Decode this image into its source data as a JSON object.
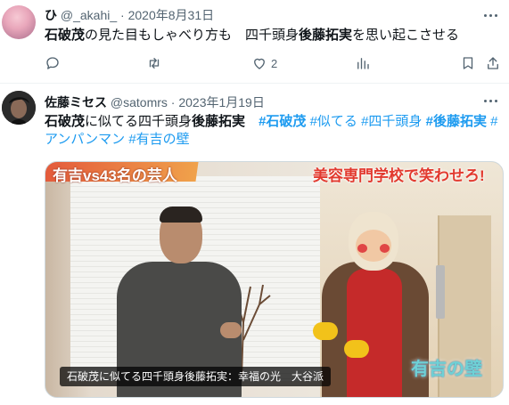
{
  "tweets": [
    {
      "display_name": "ひ",
      "handle": "@_akahi_",
      "separator": "·",
      "date": "2020年8月31日",
      "text_parts": [
        {
          "text": "石破茂",
          "style": "bold"
        },
        {
          "text": "の見た目もしゃべり方も　四千頭身",
          "style": "plain"
        },
        {
          "text": "後藤拓実",
          "style": "bold"
        },
        {
          "text": "を思い起こさせる",
          "style": "plain"
        }
      ],
      "actions": {
        "reply": {
          "icon": "reply-icon",
          "count": ""
        },
        "retweet": {
          "icon": "retweet-icon",
          "count": ""
        },
        "like": {
          "icon": "heart-icon",
          "count": "2"
        },
        "views": {
          "icon": "views-icon",
          "count": ""
        },
        "bookmark": {
          "icon": "bookmark-icon"
        },
        "share": {
          "icon": "share-icon"
        }
      }
    },
    {
      "display_name": "佐藤ミセス",
      "handle": "@satomrs",
      "separator": "·",
      "date": "2023年1月19日",
      "text_parts": [
        {
          "text": "石破茂",
          "style": "bold"
        },
        {
          "text": "に似てる四千頭身",
          "style": "plain"
        },
        {
          "text": "後藤拓実",
          "style": "bold"
        },
        {
          "text": "　",
          "style": "plain"
        },
        {
          "text": "#石破茂",
          "style": "tag-bold"
        },
        {
          "text": " ",
          "style": "plain"
        },
        {
          "text": "#似てる",
          "style": "tag"
        },
        {
          "text": " ",
          "style": "plain"
        },
        {
          "text": "#四千頭身",
          "style": "tag"
        },
        {
          "text": " ",
          "style": "plain"
        },
        {
          "text": "#後藤拓実",
          "style": "tag-bold"
        },
        {
          "text": " ",
          "style": "plain"
        },
        {
          "text": "#アンパンマン",
          "style": "tag"
        },
        {
          "text": " ",
          "style": "plain"
        },
        {
          "text": "#有吉の壁",
          "style": "tag"
        }
      ],
      "media": {
        "banner_left": "有吉vs43名の芸人",
        "banner_right": "美容専門学校で笑わせろ!",
        "logo": "有吉の壁",
        "caption": "石破茂に似てる四千頭身後藤拓実：幸福の光　大谷派"
      }
    }
  ],
  "colors": {
    "link": "#1d9bf0",
    "text": "#0f1419",
    "meta": "#536471",
    "divider": "#eff3f4"
  }
}
